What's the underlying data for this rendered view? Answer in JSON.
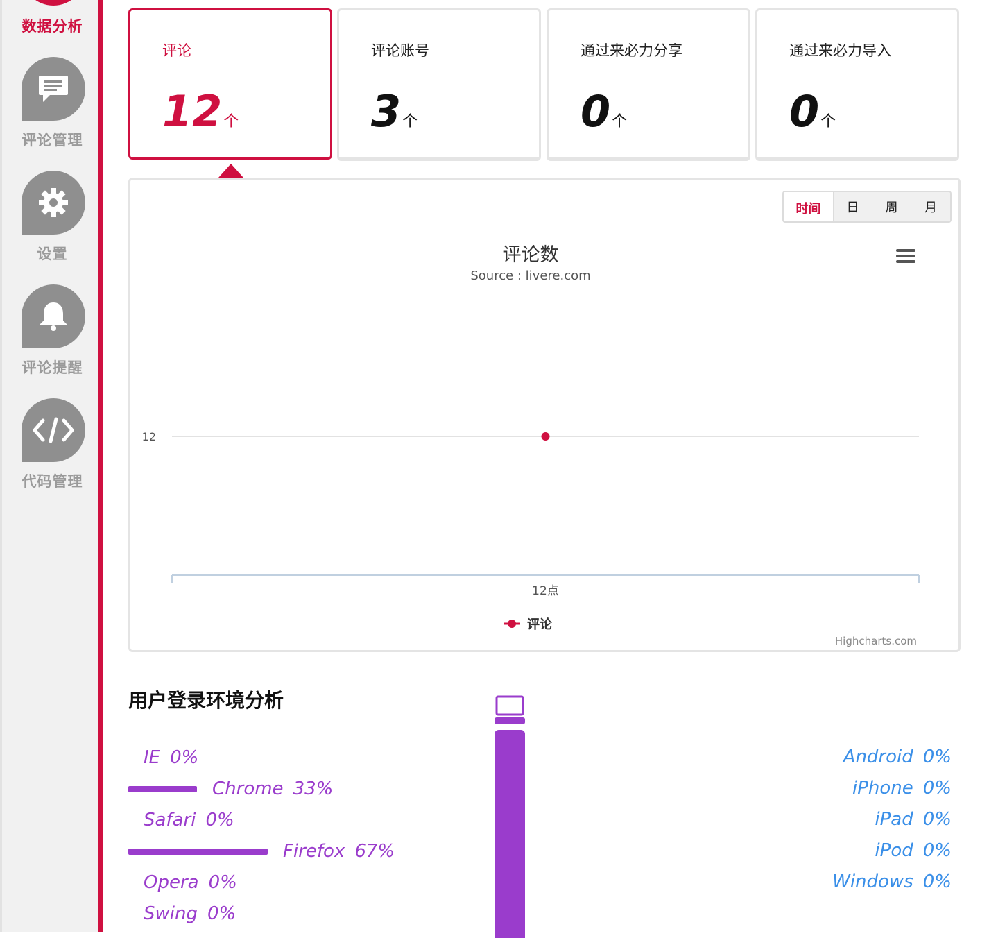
{
  "sidebar": {
    "items": [
      {
        "label": "数据分析",
        "icon": "chart-icon",
        "active": true
      },
      {
        "label": "评论管理",
        "icon": "comment-icon"
      },
      {
        "label": "设置",
        "icon": "gear-icon"
      },
      {
        "label": "评论提醒",
        "icon": "bell-icon"
      },
      {
        "label": "代码管理",
        "icon": "code-icon"
      }
    ]
  },
  "stats": [
    {
      "title": "评论",
      "value": "12",
      "unit": "个",
      "active": true
    },
    {
      "title": "评论账号",
      "value": "3",
      "unit": "个"
    },
    {
      "title": "通过来必力分享",
      "value": "0",
      "unit": "个"
    },
    {
      "title": "通过来必力导入",
      "value": "0",
      "unit": "个"
    }
  ],
  "period_buttons": [
    "时间",
    "日",
    "周",
    "月"
  ],
  "chart_data": {
    "type": "line",
    "title": "评论数",
    "subtitle": "Source : livere.com",
    "categories": [
      "12点"
    ],
    "series": [
      {
        "name": "评论",
        "values": [
          12
        ],
        "color": "#cf1040"
      }
    ],
    "ytick_labels": [
      "12"
    ],
    "legend": "bottom-center",
    "credits": "Highcharts.com"
  },
  "env": {
    "title": "用户登录环境分析",
    "browsers": [
      {
        "name": "IE",
        "pct": "0%",
        "value": 0
      },
      {
        "name": "Chrome",
        "pct": "33%",
        "value": 33
      },
      {
        "name": "Safari",
        "pct": "0%",
        "value": 0
      },
      {
        "name": "Firefox",
        "pct": "67%",
        "value": 67
      },
      {
        "name": "Opera",
        "pct": "0%",
        "value": 0
      },
      {
        "name": "Swing",
        "pct": "0%",
        "value": 0
      }
    ],
    "os": [
      {
        "name": "Android",
        "pct": "0%"
      },
      {
        "name": "iPhone",
        "pct": "0%"
      },
      {
        "name": "iPad",
        "pct": "0%"
      },
      {
        "name": "iPod",
        "pct": "0%"
      },
      {
        "name": "Windows",
        "pct": "0%"
      }
    ],
    "device": {
      "icon": "laptop-icon",
      "value": 100
    }
  },
  "colors": {
    "accent": "#cf1040",
    "browser": "#9a3ccc",
    "os": "#3a8fe8"
  }
}
